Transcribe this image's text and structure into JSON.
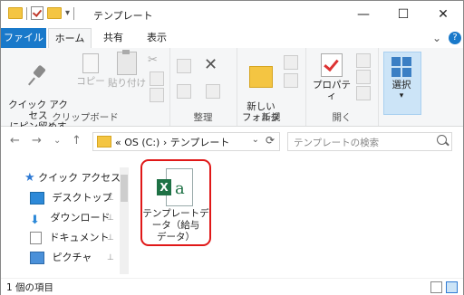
{
  "window": {
    "title": "テンプレート",
    "minimize": "—",
    "maximize": "☐",
    "close": "✕"
  },
  "ribbon_tabs": {
    "file": "ファイル",
    "home": "ホーム",
    "share": "共有",
    "view": "表示",
    "collapse": "⌄",
    "help": "?"
  },
  "ribbon": {
    "clipboard": {
      "pin_label": "クイック アクセス\nにピン留めする",
      "copy_label": "コピー",
      "paste_label": "貼り付け",
      "group_label": "クリップボード"
    },
    "organize": {
      "group_label": "整理"
    },
    "new": {
      "new_folder_label": "新しい\nフォルダー",
      "group_label": "新規"
    },
    "open": {
      "properties_label": "プロパティ",
      "group_label": "開く"
    },
    "select": {
      "select_label": "選択"
    }
  },
  "navigation": {
    "back": "←",
    "forward": "→",
    "recent": "⌄",
    "up": "↑",
    "address_text": "« OS (C:) › テンプレート",
    "address_dropdown": "⌄",
    "refresh": "⟳",
    "search_placeholder": "テンプレートの検索"
  },
  "nav_pane": {
    "items": [
      {
        "label": "クイック アクセス"
      },
      {
        "label": "デスクトップ"
      },
      {
        "label": "ダウンロード"
      },
      {
        "label": "ドキュメント"
      },
      {
        "label": "ピクチャ"
      }
    ],
    "pin_glyph": "📌"
  },
  "files": [
    {
      "name": "テンプレートデータ（給与データ）",
      "name_line1": "テンプレートデ",
      "name_line2": "ータ（給与",
      "name_line3": "データ）",
      "icon": "excel-icon"
    }
  ],
  "status_bar": {
    "item_count": "1 個の項目"
  },
  "colors": {
    "accent": "#1979ca",
    "highlight": "#e01818",
    "excel": "#1e7145"
  }
}
